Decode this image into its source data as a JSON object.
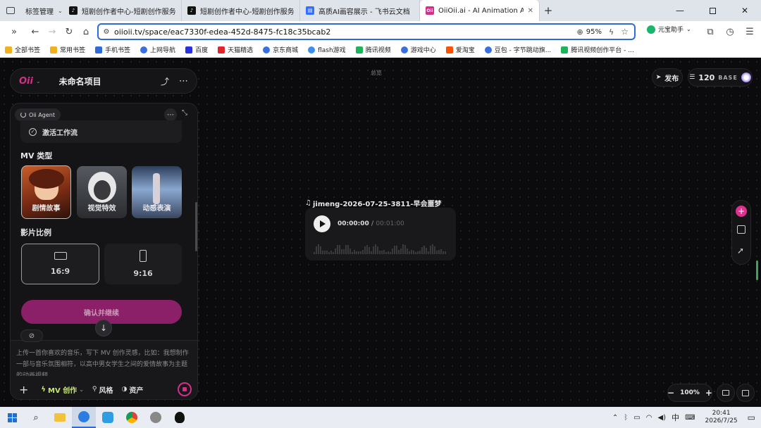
{
  "browser": {
    "tabs": [
      {
        "label": "标签管理",
        "icon": "tab-manager-icon"
      },
      {
        "label": "短剧创作者中心-短剧创作服务平台",
        "icon": "douyin-icon"
      },
      {
        "label": "短剧创作者中心-短剧创作服务平台",
        "icon": "douyin-icon"
      },
      {
        "label": "高质AI画容展示 - 飞书云文档",
        "icon": "feishu-icon"
      },
      {
        "label": "OiiOii.ai - AI Animation Agent",
        "icon": "oii-icon"
      }
    ],
    "url": "oiioii.tv/space/eac7330f-edea-452d-8475-fc18c35bcab2",
    "zoom": "95%",
    "assistant_label": "元宝助手",
    "bookmarks": [
      "全部书签",
      "常用书签",
      "手机书签",
      "上网导航",
      "百度",
      "天猫精选",
      "京东商城",
      "flash游戏",
      "腾讯视频",
      "游戏中心",
      "爱淘宝",
      "豆包 - 字节跳动旗...",
      "腾讯视频创作平台 - ..."
    ]
  },
  "app": {
    "logo": "Oii",
    "project_title": "未命名项目",
    "canvas_label": "总览",
    "publish_label": "发布",
    "credits": "120",
    "plan": "BASE",
    "zoom": "100%",
    "agent": {
      "badge": "Oii Agent",
      "workflow_item": "激活工作流",
      "mv_type_heading": "MV 类型",
      "mv_types": [
        "剧情故事",
        "视觉特效",
        "动感表演"
      ],
      "ratio_heading": "影片比例",
      "ratios": [
        "16:9",
        "9:16"
      ],
      "confirm_button": "确认并继续",
      "input_placeholder": "上传一首你喜欢的音乐，写下 MV 创作灵感，比如：我想制作一部与音乐氛围相符，以高中男女学生之间的爱情故事为主题的动画视频",
      "mode_label": "MV 创作",
      "style_label": "风格",
      "assets_label": "资产"
    },
    "audio_node": {
      "title": "jimeng-2026-07-25-3811-早会噩梦",
      "current_time": "00:00:00",
      "separator": "/",
      "total_time": "00:01:00"
    }
  },
  "taskbar": {
    "ime": "中",
    "time": "20:41",
    "date": "2026/7/25"
  },
  "colors": {
    "accent": "#d42e8b",
    "confirm": "#8c2068",
    "url_border": "#2f6bd8"
  }
}
